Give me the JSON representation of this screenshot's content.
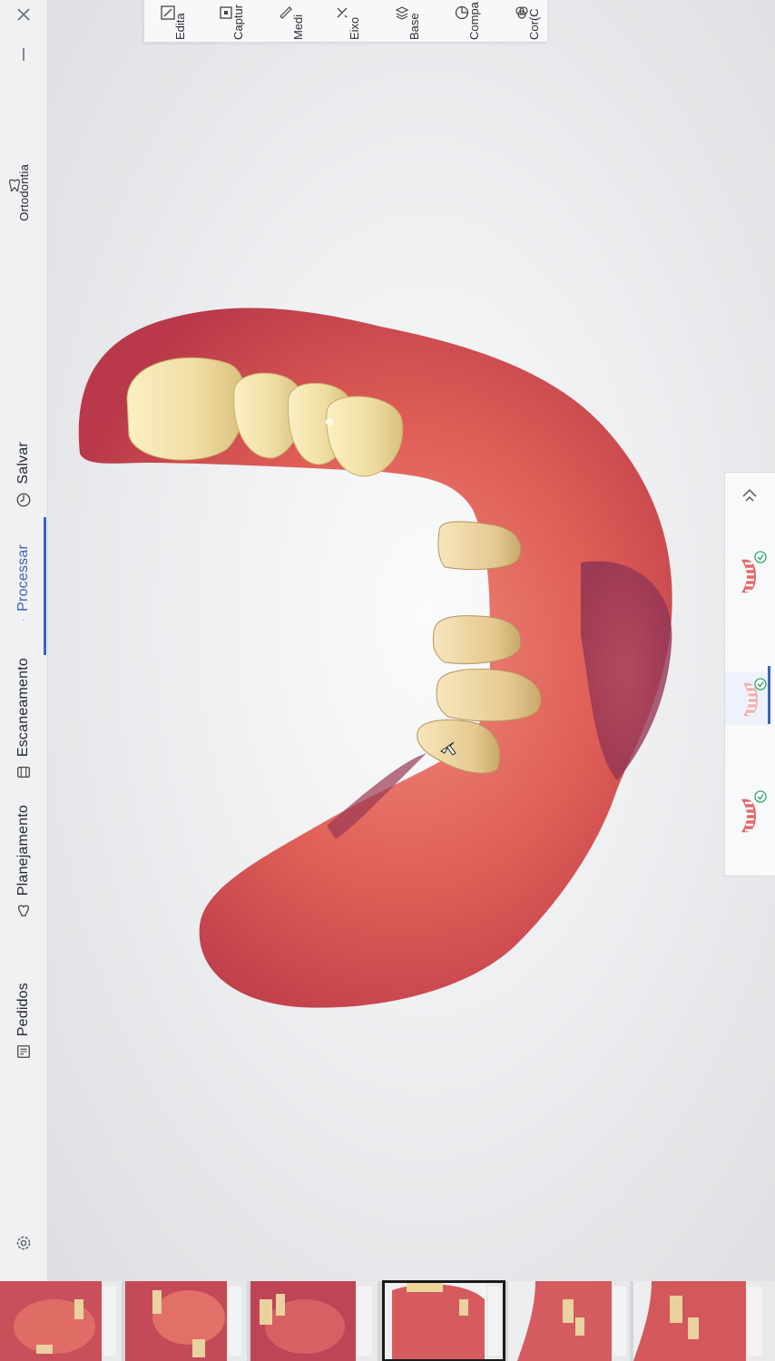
{
  "nav": {
    "items": [
      {
        "id": "ortodontia",
        "label": "Ortodontia",
        "icon": "tooth-icon"
      },
      {
        "id": "salvar",
        "label": "Salvar",
        "icon": "clock-icon"
      },
      {
        "id": "processar",
        "label": "Processar",
        "icon": "process-icon",
        "active": true
      },
      {
        "id": "escaneamento",
        "label": "Escaneamento",
        "icon": "scan-icon"
      },
      {
        "id": "planejamento",
        "label": "Planejamento",
        "icon": "planning-icon"
      },
      {
        "id": "pedidos",
        "label": "Pedidos",
        "icon": "orders-icon"
      }
    ],
    "settings_icon": "gear-icon",
    "close_icon": "close-icon",
    "minimize_icon": "minimize-icon"
  },
  "toolbar": {
    "items": [
      {
        "label": "Edita",
        "icon": "edit-icon"
      },
      {
        "label": "Captur",
        "icon": "capture-icon"
      },
      {
        "label": "Medi",
        "icon": "measure-icon"
      },
      {
        "label": "Eixo",
        "icon": "axis-icon"
      },
      {
        "label": "Base",
        "icon": "layers-icon"
      },
      {
        "label": "Compa",
        "icon": "compare-icon"
      },
      {
        "label": "Cor(C",
        "icon": "color-icon"
      }
    ]
  },
  "jaws": {
    "collapse_icon": "chevron-up-icon",
    "items": [
      {
        "name": "upper-jaw-icon",
        "status": "check-icon"
      },
      {
        "name": "both-jaws-icon",
        "status": "check-icon",
        "selected": true
      },
      {
        "name": "lower-jaw-icon",
        "status": "check-icon"
      }
    ]
  },
  "thumbnails": {
    "count": 6,
    "selected_index": 3
  },
  "colors": {
    "accent": "#3c63c0",
    "gum": "#d9584f",
    "tooth": "#efe0a6"
  }
}
